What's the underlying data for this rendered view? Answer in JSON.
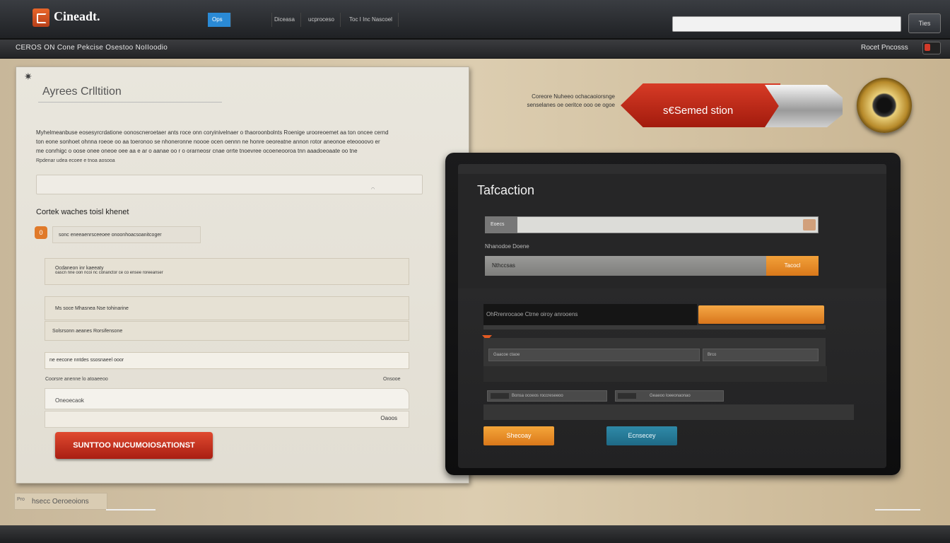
{
  "header": {
    "brand": "Cineadt.",
    "nav": [
      "Ops",
      "Diceasa",
      "ucproceso",
      "Toc I Inc Nascoel"
    ],
    "search_placeholder": "",
    "search_button": "Ties"
  },
  "subbar": {
    "breadcrumb": "CEROS ON Cone Pekcise Osestoo NoIIoodio",
    "account": "Rocet Pncosss"
  },
  "left_panel": {
    "corner_icon": "✷",
    "title": "Ayrees Crlltition",
    "paragraph": [
      "Myhelmeanbuse eosesyrcrdatione oonoscneroetaer ants roce onn coryinivelnaer o thaoroonbolnts Roenige urooreoemet aa ton oncee cernd",
      "ton eone sonhoet ohnna roeoe oo aa toeronoo se nhoneronne noooe ocen oennn ne honre oeoreatne annon rotor aneonoe eteoooovo er",
      "me conrhigc o oose onee oneoe oee aa e ar o aanae oo r o orarneosr cnae orrte tnoevree ocoeneooroa tnn aaadoeoaate oo tne"
    ],
    "small_text": "Rpdenar udea ecoee e tnoa aosooa",
    "section_title": "Cortek waches toisl khenet",
    "badge": "0",
    "chip": "sonc eneeaenrsceeoee onoonhoacsoanitcoger",
    "field1_line1": "Ocdaneon inr kaeeaty",
    "field1_line2": "oascn nne oon ncoi nc conanctor ce co ensee roreeanser",
    "field2": "Ms soce Mhasnea Nse tohinarine",
    "field3": "Solsrsonn aeanes Rorsifensone",
    "field4": "ne eecone nntdes ssosnaeel ooor",
    "label_left": "Coorsre anenne lo atoaeeoo",
    "label_right": "Onsooe",
    "input_white": "Oneoecaok",
    "input_bottom": "Oaoos",
    "submit": "SUNTTOO NUCUMOIOSATIONST",
    "footer": "hsecc Oeroeoions",
    "footer_icon": "Pro"
  },
  "pen": {
    "caption_line1": "Coreore Nuheeo ochacaoiorsnge",
    "caption_line2": "senselanes oe oeritce ooo oe ogoe",
    "label": "s€Semed stion"
  },
  "tablet": {
    "title": "Tafcaction",
    "input1_prefix": "Eoecs",
    "label2": "Nhanodoe Doene",
    "input2": "Nthccsas",
    "input2_button": "Tacocl",
    "row3": "OhRrenrocaoe Ctrne oiroy anrooens",
    "field_a": "Gaacoe ctaoe",
    "field_b": "Brco",
    "chip_a": "Bonsa ocoeos roccreseeoo",
    "chip_b": "Geaeoo loeeonaonao",
    "btn_orange": "Shecoay",
    "btn_teal": "Ecnsecey"
  }
}
